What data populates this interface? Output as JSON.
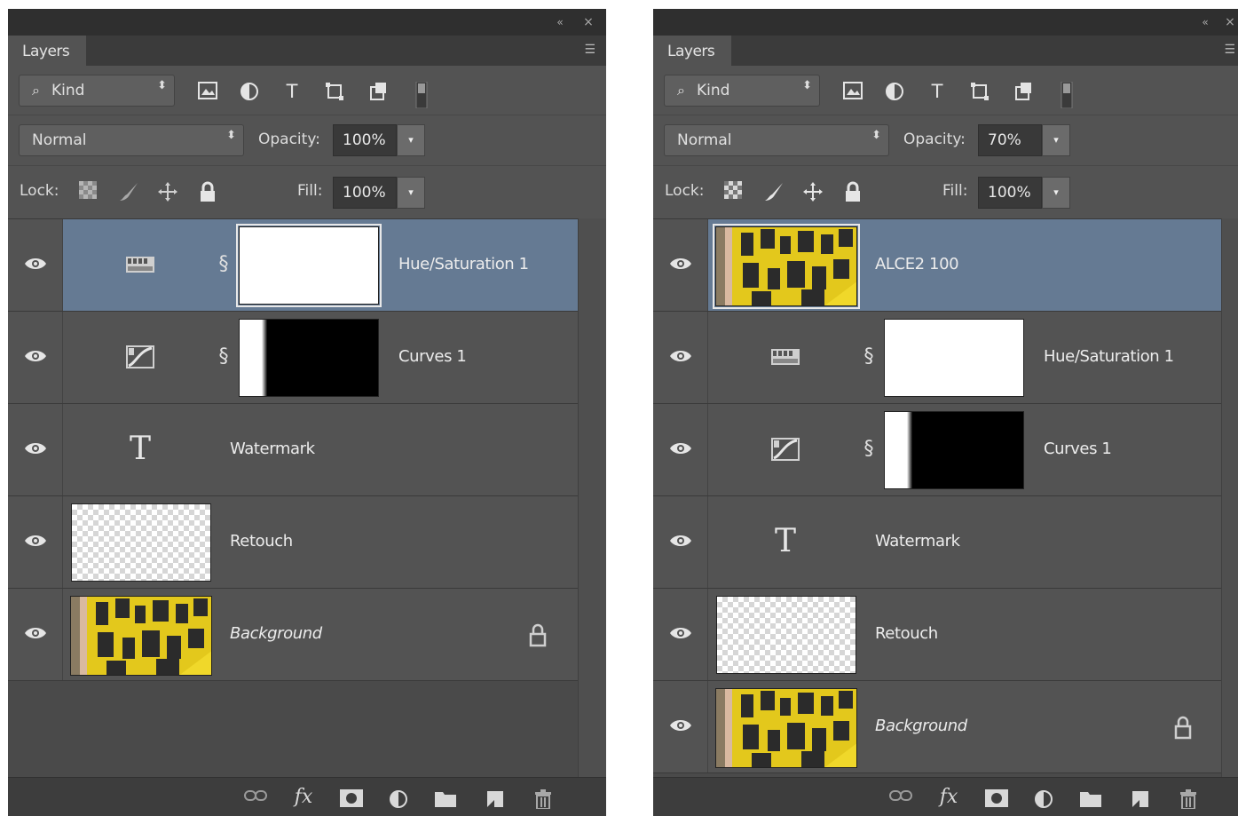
{
  "panels": [
    {
      "tab_label": "Layers",
      "filter": {
        "kind_label": "Kind"
      },
      "blend_mode": "Normal",
      "opacity_label": "Opacity:",
      "opacity_value": "100%",
      "lock_label": "Lock:",
      "fill_label": "Fill:",
      "fill_value": "100%",
      "layers": [
        {
          "name": "Hue/Saturation 1",
          "kind": "hue-saturation-adjustment",
          "selected": true,
          "visible": true
        },
        {
          "name": "Curves 1",
          "kind": "curves-adjustment",
          "selected": false,
          "visible": true
        },
        {
          "name": "Watermark",
          "kind": "text",
          "selected": false,
          "visible": true
        },
        {
          "name": "Retouch",
          "kind": "pixel-transparent",
          "selected": false,
          "visible": true
        },
        {
          "name": "Background",
          "kind": "background-photo",
          "selected": false,
          "visible": true,
          "locked": true
        }
      ]
    },
    {
      "tab_label": "Layers",
      "filter": {
        "kind_label": "Kind"
      },
      "blend_mode": "Normal",
      "opacity_label": "Opacity:",
      "opacity_value": "70%",
      "lock_label": "Lock:",
      "fill_label": "Fill:",
      "fill_value": "100%",
      "layers": [
        {
          "name": "ALCE2 100",
          "kind": "photo",
          "selected": true,
          "visible": true
        },
        {
          "name": "Hue/Saturation 1",
          "kind": "hue-saturation-adjustment",
          "selected": false,
          "visible": true
        },
        {
          "name": "Curves 1",
          "kind": "curves-adjustment",
          "selected": false,
          "visible": true
        },
        {
          "name": "Watermark",
          "kind": "text",
          "selected": false,
          "visible": true
        },
        {
          "name": "Retouch",
          "kind": "pixel-transparent",
          "selected": false,
          "visible": true
        },
        {
          "name": "Background",
          "kind": "background-photo",
          "selected": false,
          "visible": true,
          "locked": true
        }
      ]
    }
  ],
  "icons": {
    "collapse": "«",
    "close": "×",
    "panel_menu": "☰",
    "text_layer": "T",
    "chain": "§",
    "fx": "fx",
    "select_arrows": "⬍",
    "dropdown": "▾",
    "search": "⌕"
  },
  "colors": {
    "panel_bg": "#535353",
    "selected_row": "#657a93",
    "photo_yellow": "#e3c81c"
  }
}
